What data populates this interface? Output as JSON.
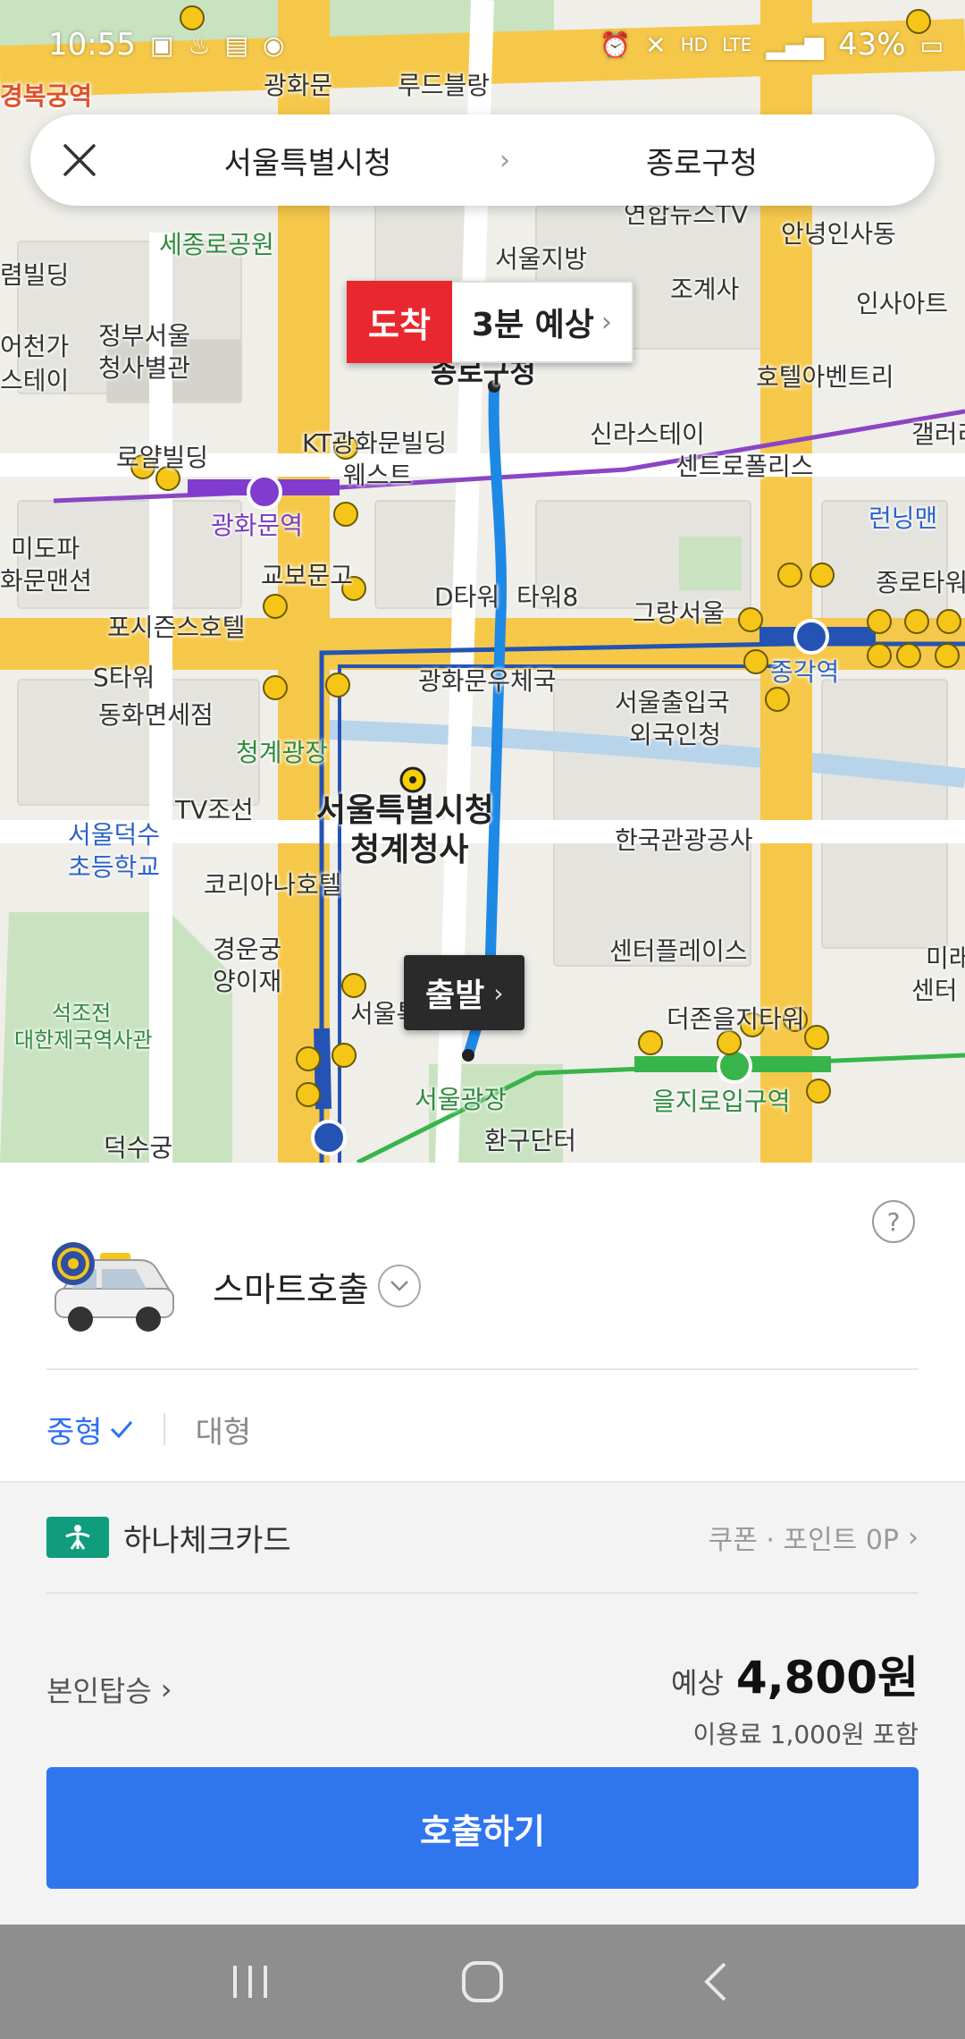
{
  "status_bar": {
    "time": "10:55",
    "battery": "43%",
    "network_hd": "HD",
    "network_lte": "LTE"
  },
  "route": {
    "origin": "서울특별시청",
    "arrow": "›",
    "destination": "종로구청"
  },
  "map": {
    "arrival_tag": "도착",
    "arrival_eta": "3분 예상",
    "departure_tag": "출발",
    "chevron": "›",
    "labels": {
      "gwanghwamun": "광화문",
      "rudeubeulang": "루드블랑",
      "gyeongbokgung": "경복궁역",
      "yonhap": "연합뉴스TV",
      "sejongro_park": "세종로공원",
      "seoul_regional": "서울지방",
      "jogyesa": "조계사",
      "anguk": "안녕인사동",
      "insa_art": "인사아트",
      "govt_seoul": "정부서울",
      "govt_seoul2": "청사별관",
      "jongno_gu": "종로구청",
      "hotel_ambient": "호텔아벤트리",
      "kt_building": "KT광화문빌딩",
      "kt_west": "웨스트",
      "shilla_stay": "신라스테이",
      "centropolis": "센트로폴리스",
      "gwanghwamun_stn": "광화문역",
      "running_man": "런닝맨",
      "royal_building": "로얄빌딩",
      "kyobo": "교보문고",
      "d_tower": "D타워",
      "tower8": "타워8",
      "grang_seoul": "그랑서울",
      "jonggak_stn": "종각역",
      "four_seasons": "포시즌스호텔",
      "s_tower": "S타워",
      "gwanghwamun_post": "광화문우체국",
      "donghwa": "동화면세점",
      "seoul_exit": "서울출입국",
      "foreign_office": "외국인청",
      "cheonggye": "청계광장",
      "tv_chosun": "TV조선",
      "city_hall_annex": "서울특별시청",
      "city_hall_annex2": "청계청사",
      "kto": "한국관광공사",
      "deoksu_school": "서울덕수",
      "deoksu_school2": "초등학교",
      "koreana": "코리아나호텔",
      "center_place": "센터플레이스",
      "gyeongungung": "경운궁",
      "yangijae": "양이재",
      "city_hall": "서울특별시청",
      "the_zone": "더존을지타워",
      "seokjojeon": "석조전",
      "daehan_museum": "대한제국역사관",
      "seoul_plaza": "서울광장",
      "euljiro_stn": "을지로입구역",
      "deoksugung": "덕수궁",
      "hwangu": "환구단터",
      "mido": "미도파",
      "hwamun_mansion": "화문맨션",
      "mirae": "미래",
      "center": "센터",
      "jongno_tower": "종로타워",
      "galleria": "갤러리",
      "hotel_kyj": "어천가",
      "hotel_kyj2": "스테이",
      "hyeon_building": "렴빌딩"
    }
  },
  "sheet": {
    "help": "?",
    "service_name": "스마트호출",
    "size_medium": "중형",
    "size_large": "대형",
    "card_name": "하나체크카드",
    "coupon_points": "쿠폰 · 포인트 0P",
    "self_ride": "본인탑승",
    "fare_prefix": "예상",
    "fare_amount": "4,800원",
    "fare_note": "이용료 1,000원 포함",
    "call_button": "호출하기"
  },
  "colors": {
    "accent_blue": "#2f75ee",
    "arrival_red": "#e8282e",
    "route_blue": "#1e88e5",
    "card_green": "#0f9d7e"
  }
}
